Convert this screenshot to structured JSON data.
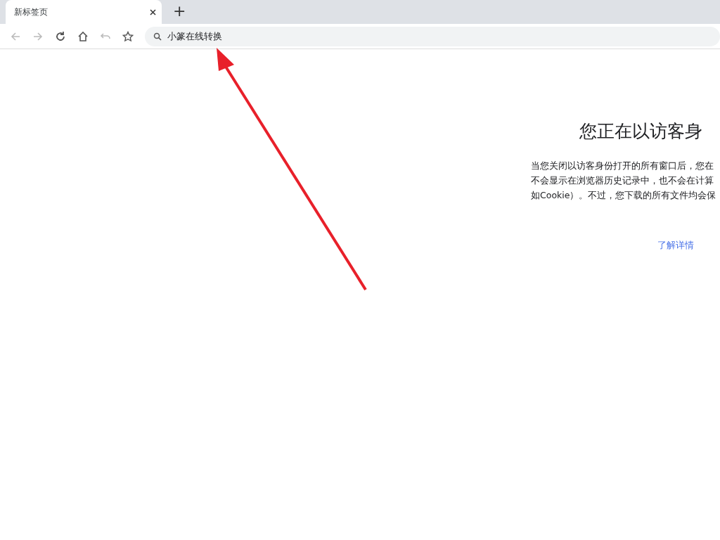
{
  "tabs": [
    {
      "title": "新标签页",
      "selected": true
    }
  ],
  "new_tab_button": "+",
  "toolbar": {
    "back_disabled": true,
    "forward_disabled": true,
    "address": "小篆在线转换"
  },
  "content": {
    "title": "您正在以访客身",
    "lines": [
      "当您关闭以访客身份打开的所有窗口后，您在",
      "不会显示在浏览器历史记录中，也不会在计算",
      "如Cookie）。不过，您下载的所有文件均会保"
    ],
    "link": "了解详情"
  }
}
